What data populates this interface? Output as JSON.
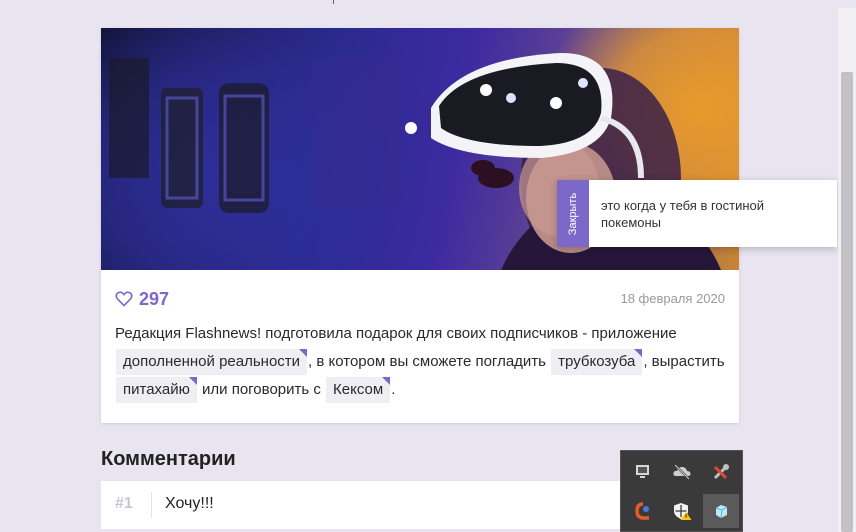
{
  "article": {
    "likes": "297",
    "date": "18 февраля 2020",
    "text_1": "Редакция Flashnews! подготовила подарок для своих подписчиков - приложение ",
    "tag_1": "дополненной реальности",
    "text_2": ", в котором вы сможете погладить ",
    "tag_2": "трубкозуба",
    "text_3": ", вырастить ",
    "tag_3": "питахайю",
    "text_4": " или поговорить с ",
    "tag_4": "Кексом",
    "text_5": "."
  },
  "popover": {
    "close_label": "Закрыть",
    "text": "это когда у тебя в гостиной покемоны"
  },
  "comments": {
    "title": "Комментарии",
    "items": [
      {
        "num": "#1",
        "text": "Хочу!!!"
      }
    ]
  },
  "tray": {
    "icons": [
      "display-icon",
      "cloud-off-icon",
      "tools-icon",
      "antivirus-icon",
      "security-warning-icon",
      "cube-icon"
    ]
  },
  "colors": {
    "accent": "#7b68c8",
    "background": "#e8e5f0",
    "tray": "#3a3a3a"
  }
}
